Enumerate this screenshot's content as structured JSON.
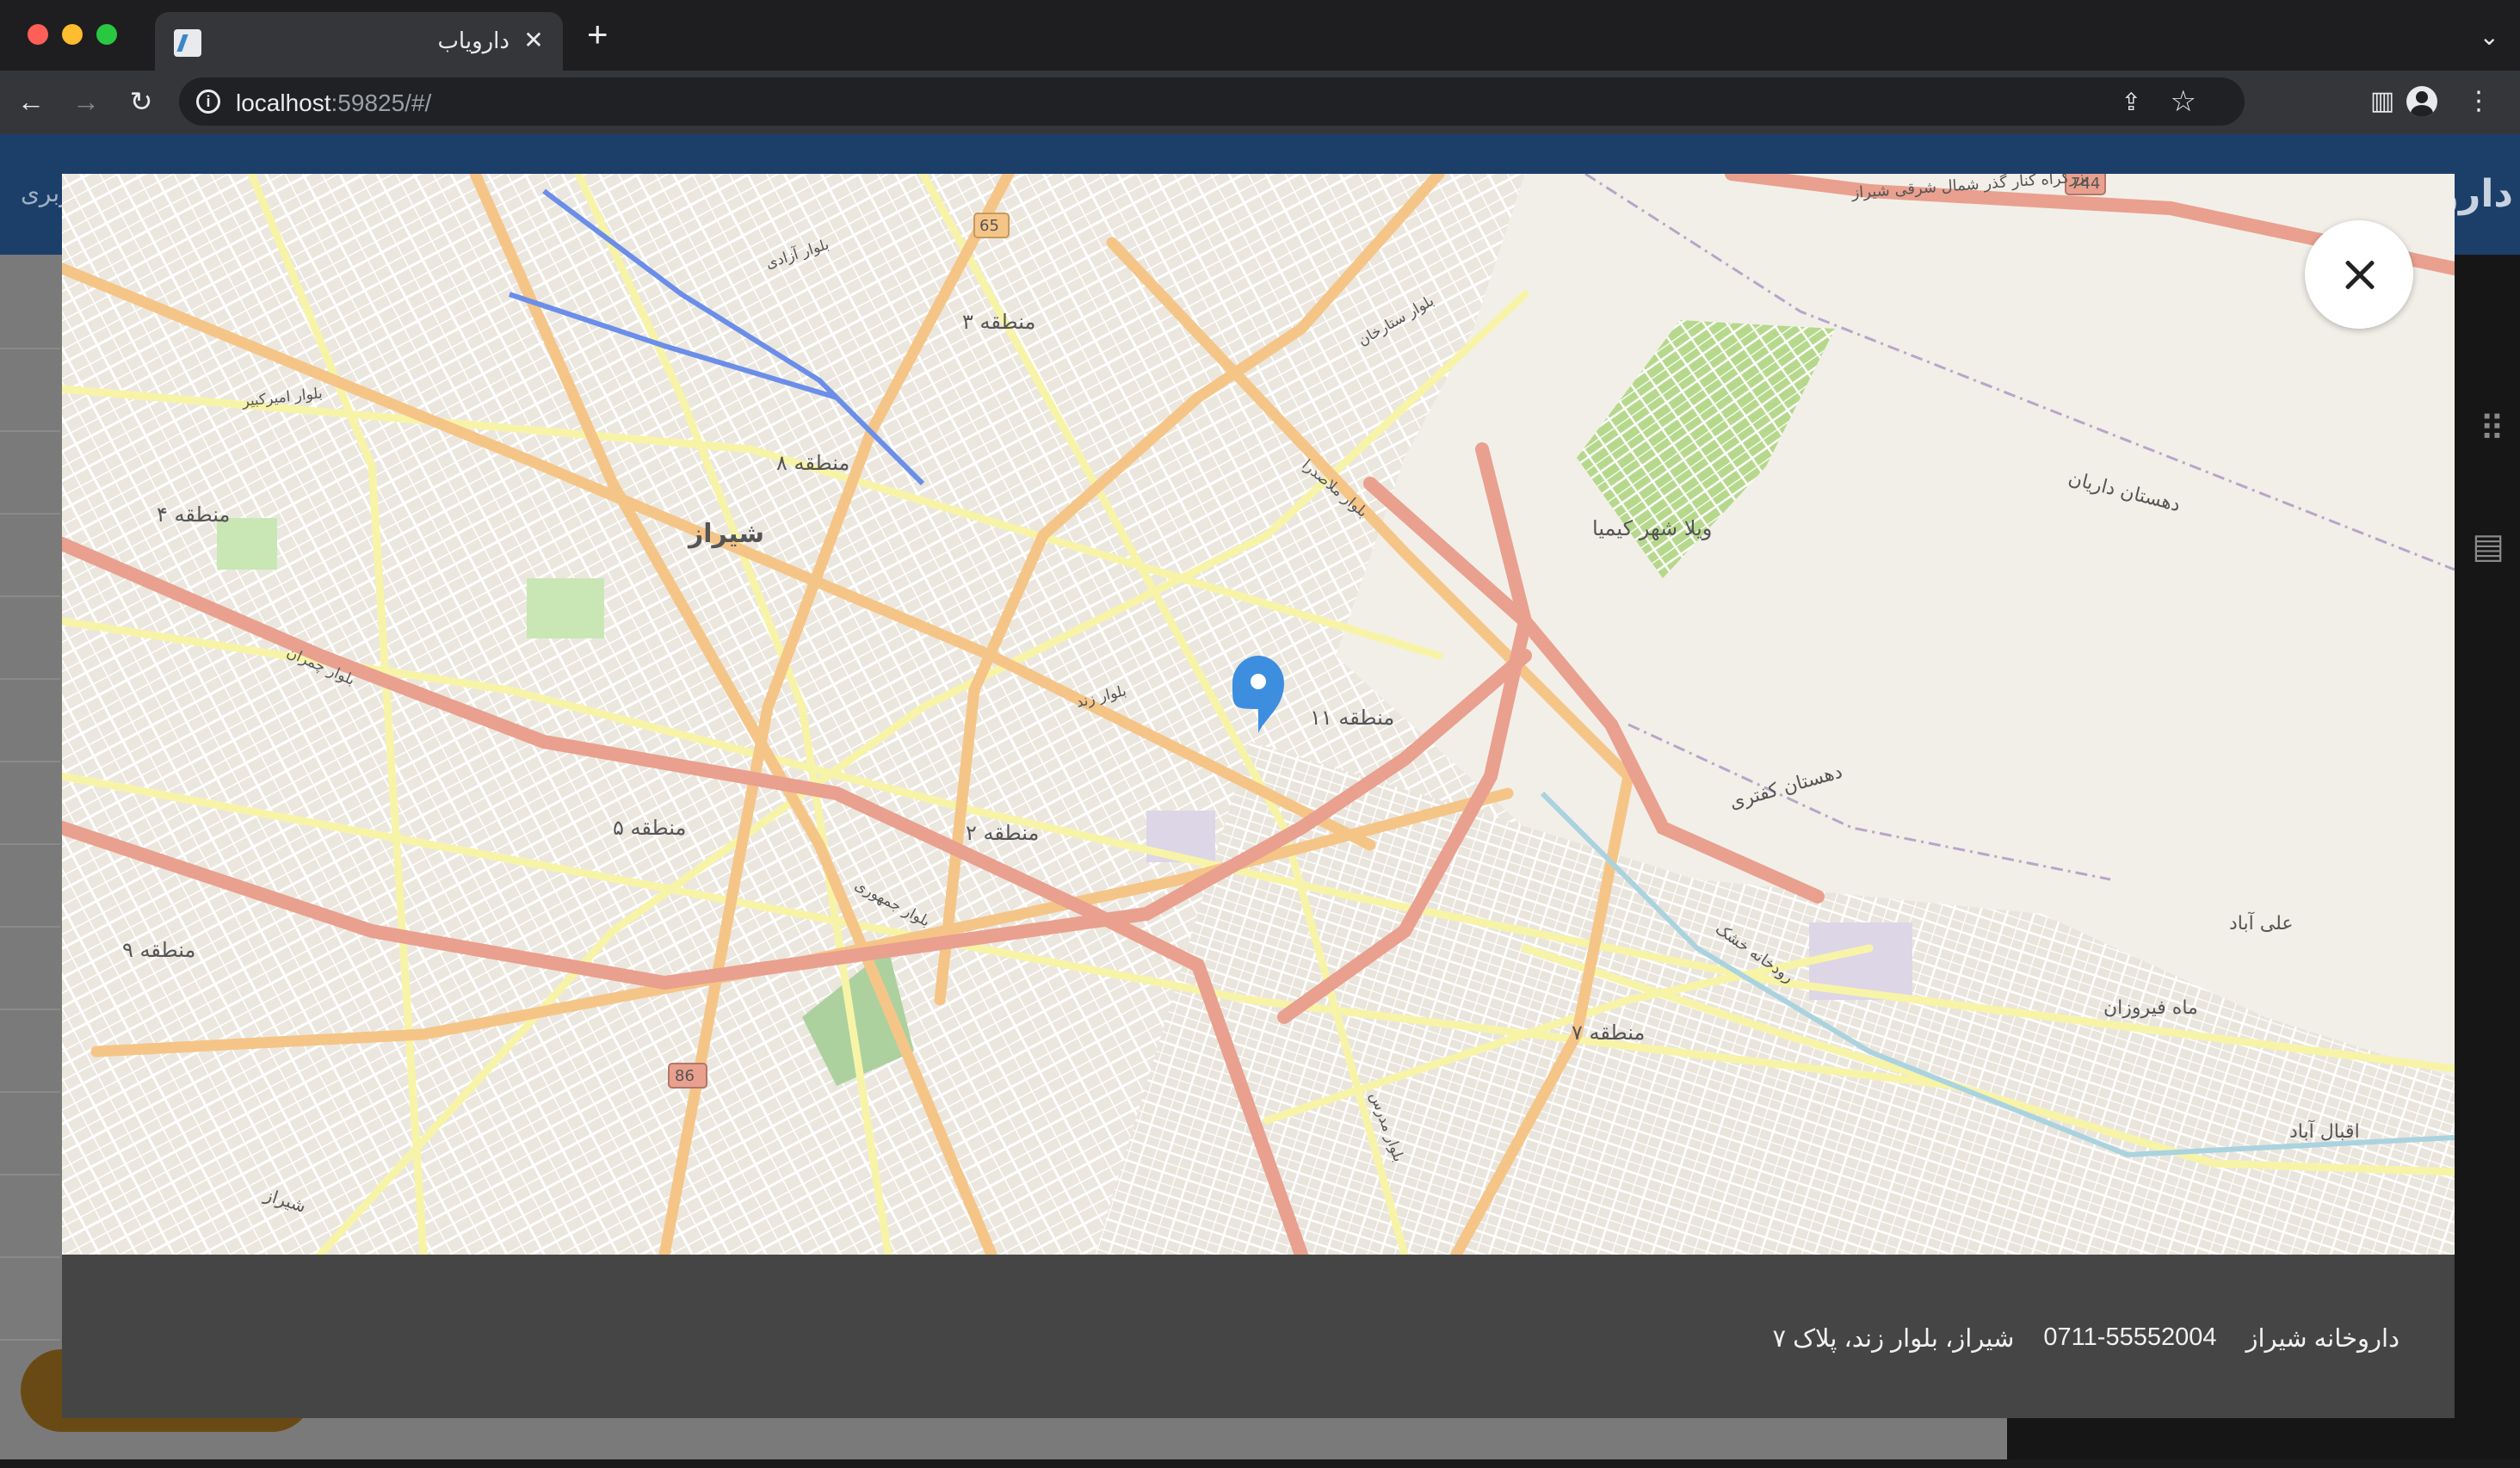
{
  "browser": {
    "tab_title": "دارویاب",
    "tab_close": "✕",
    "new_tab": "+",
    "url_host": "localhost",
    "url_rest": ":59825/#/",
    "tab_menu": "⌄"
  },
  "app": {
    "brand": "دارو",
    "header_link": "ربری"
  },
  "map": {
    "marker_color": "#3d8ede",
    "labels": {
      "shiraz": "شیراز",
      "region2": "منطقه ۲",
      "region3": "منطقه ۳",
      "region4": "منطقه ۴",
      "region5": "منطقه ۵",
      "region7": "منطقه ۷",
      "region8": "منطقه ۸",
      "region9": "منطقه ۹",
      "region11": "منطقه ۱۱",
      "villa": "ویلا شهر کیمیا",
      "dehestan_daryan": "دهستان داریان",
      "dehestan_kafari": "دهستان کفتری",
      "aliabad": "علی آباد",
      "mahfirouzan": "ماه فیروزان",
      "eghbalabad": "اقبال آباد",
      "road_744": "744",
      "road_65": "65",
      "road_86": "86",
      "shiraz_south": "شیراز",
      "highway_label": "بزرگراه کنار گذر شمال شرقی شیراز",
      "river": "رودخانه خشک",
      "blvd_zand": "بلوار زند",
      "blvd_mollasadra": "بلوار ملاصدرا",
      "blvd_chamran": "بلوار چمران",
      "blvd_rahmat": "بلوار جمهوری",
      "blvd_azadi": "بلوار آزادی",
      "blvd_sattar": "بلوار ستارخان",
      "blvd_modarres": "بلوار مدرس",
      "blvd_amirkabir": "بلوار امیرکبیر"
    }
  },
  "pharmacy": {
    "name": "داروخانه شیراز",
    "phone": "0711-55552004",
    "address": "شیراز، بلوار زند، پلاک ۷"
  }
}
